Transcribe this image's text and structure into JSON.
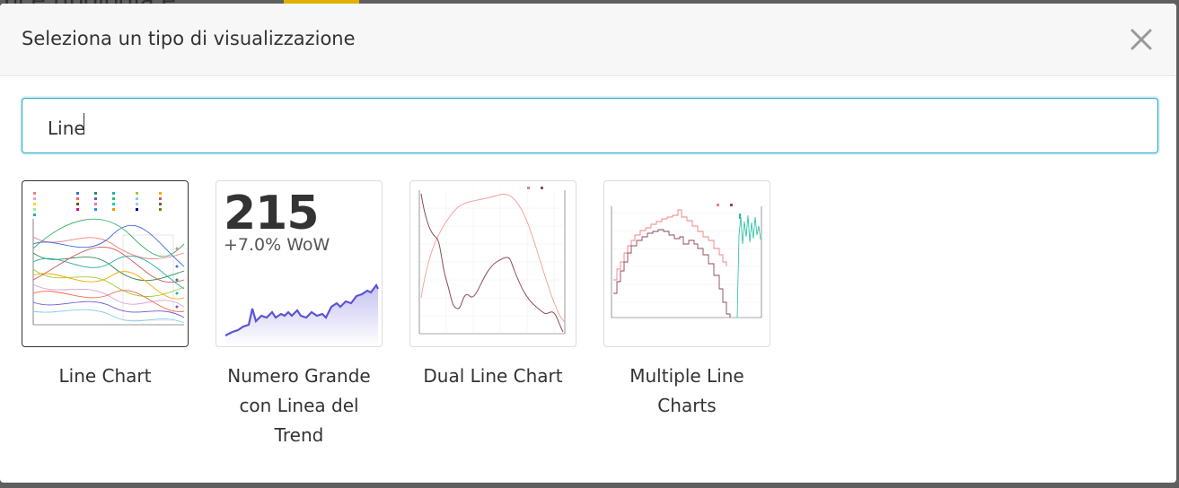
{
  "background": {
    "title_fragment": "nce tipologia e"
  },
  "modal": {
    "title": "Seleziona un tipo di visualizzazione",
    "close_icon": "close-icon"
  },
  "search": {
    "value": "Line"
  },
  "cards": [
    {
      "label": "Line Chart",
      "selected": true
    },
    {
      "label": "Numero Grande con Linea del Trend",
      "big_number": "215",
      "sub_text": "+7.0% WoW",
      "selected": false
    },
    {
      "label": "Dual Line Chart",
      "selected": false
    },
    {
      "label": "Multiple Line Charts",
      "selected": false
    }
  ],
  "colors": {
    "accent": "#20a7c9",
    "trend_line": "#5b54d6"
  }
}
